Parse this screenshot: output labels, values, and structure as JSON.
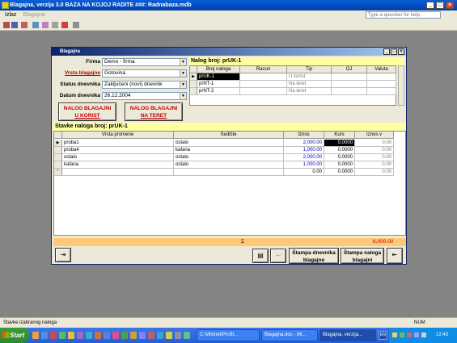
{
  "window": {
    "title": "Blagajna, verzija 3.0    BAZA NA KOJOJ RADITE  ###: Radnabaza.mdb",
    "help_placeholder": "Type a question for help"
  },
  "menu": {
    "items": [
      "Izlaz",
      "Blagajna"
    ]
  },
  "form": {
    "title": "Blagajna",
    "labels": {
      "firma": "Firma",
      "vrsta": "Vrsta blagajne",
      "status": "Status dnevnika",
      "datum": "Datum dnevnika"
    },
    "values": {
      "firma": "Demo - firma",
      "vrsta": "Gotovina",
      "status": "Zaključeni (novi) dnevnik",
      "datum": "26.12.2004"
    },
    "btn_korist": [
      "NALOG BLAGAJNI",
      "U KORIST"
    ],
    "btn_teret": [
      "NALOG BLAGAJNI",
      "NA TERET"
    ],
    "nalog_header": "Nalog broj: prUK-1",
    "nalog_columns": [
      "Broj naloga",
      "Racun",
      "Tip",
      "OJ",
      "Valuta"
    ],
    "nalog_rows": [
      {
        "broj": "prUK-1",
        "racun": "",
        "tip": "U korist",
        "oj": "",
        "valuta": ""
      },
      {
        "broj": "prNT-1",
        "racun": "",
        "tip": "Na teret",
        "oj": "",
        "valuta": ""
      },
      {
        "broj": "prNT-2",
        "racun": "",
        "tip": "Na teret",
        "oj": "",
        "valuta": ""
      }
    ],
    "stavke_header": "Stavke naloga broj: prUK-1",
    "stavke_columns": [
      "Vrsta promene",
      "Sedište",
      "Iznos",
      "Kurs",
      "Iznos v"
    ],
    "stavke_rows": [
      {
        "vrsta": "proba1",
        "sed": "ostalo",
        "iznos": "2,000.00",
        "kurs": "0.0000",
        "iznosv": "0.00"
      },
      {
        "vrsta": "proba4",
        "sed": "kafana",
        "iznos": "1,000.00",
        "kurs": "0.0000",
        "iznosv": "0.00"
      },
      {
        "vrsta": "ostalo",
        "sed": "ostalo",
        "iznos": "2,000.00",
        "kurs": "0.0000",
        "iznosv": "0.00"
      },
      {
        "vrsta": "kafana",
        "sed": "ostalo",
        "iznos": "1,000.00",
        "kurs": "0.0000",
        "iznosv": "0.00"
      },
      {
        "vrsta": "",
        "sed": "",
        "iznos": "0.00",
        "kurs": "0.0000",
        "iznosv": "0.00"
      }
    ],
    "sigma": "Σ",
    "total": "6,000.00",
    "btn_stampa_dnevnika": [
      "Štampa dnevnika",
      "blagajne"
    ],
    "btn_stampa_naloga": [
      "Štampa naloga",
      "blagajni"
    ]
  },
  "statusbar": {
    "text": "Stavke izabranog naloga",
    "num": "NUM"
  },
  "taskbar": {
    "start": "Start",
    "tasks": [
      "C:\\Winnet\\Profit...",
      "Blagajna.doc - Mi...",
      "Blagajna, verzija..."
    ],
    "lang": "EN",
    "clock": "12:43"
  },
  "colors": {
    "accent": "#c00000",
    "yellow": "#ffffa0",
    "total_bar": "#ffc875"
  }
}
